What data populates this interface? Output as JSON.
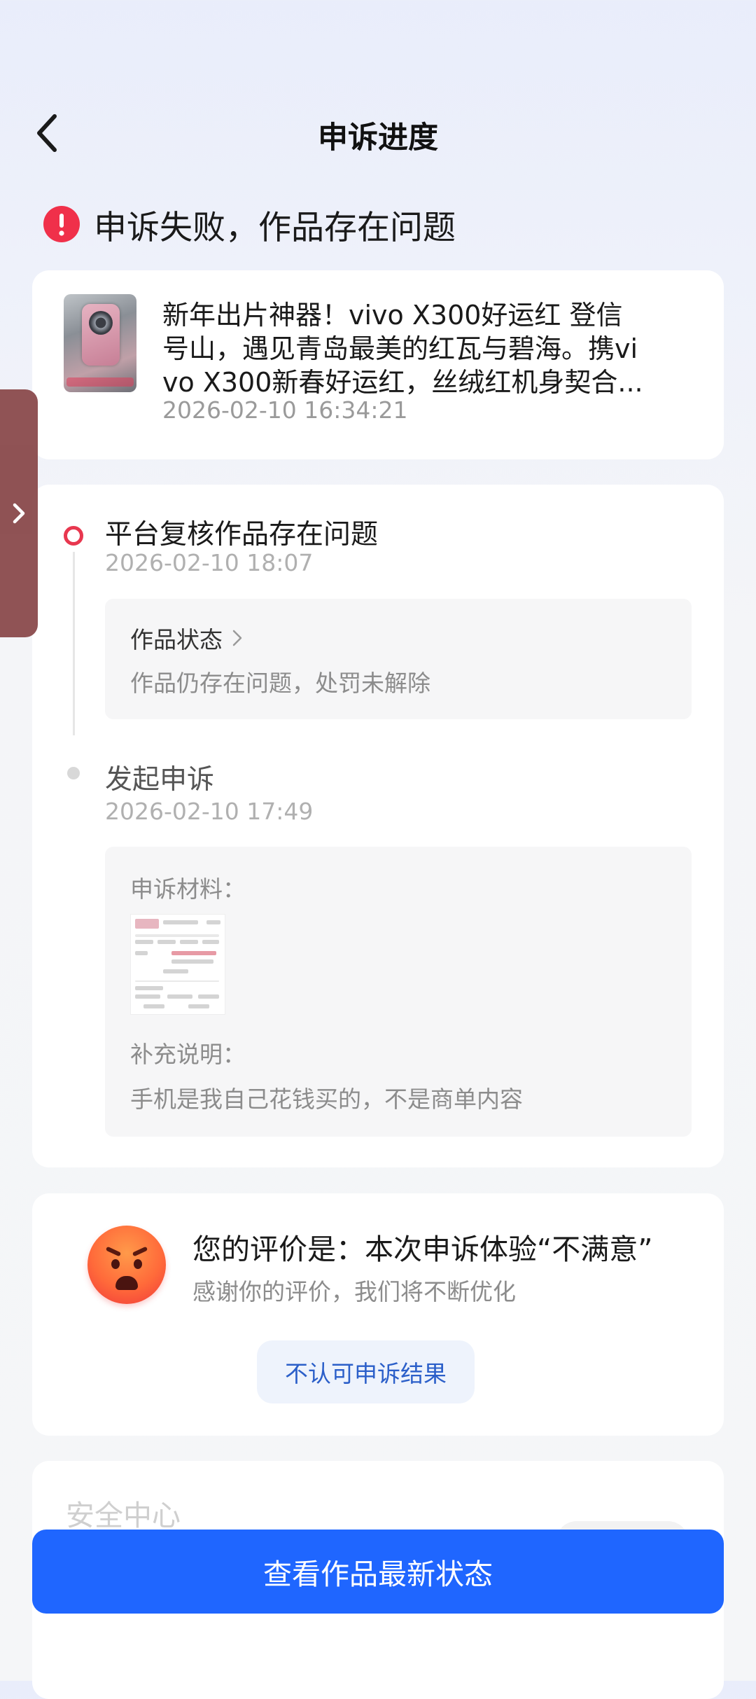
{
  "header": {
    "title": "申诉进度",
    "back_icon": "chevron-left-icon"
  },
  "status": {
    "text": "申诉失败，作品存在问题",
    "icon": "alert-icon",
    "color": "#f0304a"
  },
  "post": {
    "title_line1": "新年出片神器！vivo X300好运红 登信",
    "title_line2": "号山，遇见青岛最美的红瓦与碧海。携vi",
    "title_line3": "vo X300新春好运红，丝绒红机身契合...",
    "time": "2026-02-10 16:34:21"
  },
  "timeline": {
    "step1": {
      "title": "平台复核作品存在问题",
      "time": "2026-02-10 18:07",
      "box_heading": "作品状态",
      "box_desc": "作品仍存在问题，处罚未解除"
    },
    "step2": {
      "title": "发起申诉",
      "time": "2026-02-10 17:49",
      "materials_label": "申诉材料：",
      "supplement_label": "补充说明：",
      "supplement_text": "手机是我自己花钱买的，不是商单内容"
    }
  },
  "evaluation": {
    "title": "您的评价是：本次申诉体验“不满意”",
    "subtitle": "感谢你的评价，我们将不断优化",
    "button_label": "不认可申诉结果",
    "emoji": "angry-face-icon"
  },
  "safety": {
    "title": "安全中心"
  },
  "bottom_button": {
    "label": "查看作品最新状态",
    "color": "#1f66ff"
  },
  "colors": {
    "accent_red": "#e8374f",
    "primary_blue": "#1f66ff",
    "link_blue": "#2b5fc9"
  }
}
